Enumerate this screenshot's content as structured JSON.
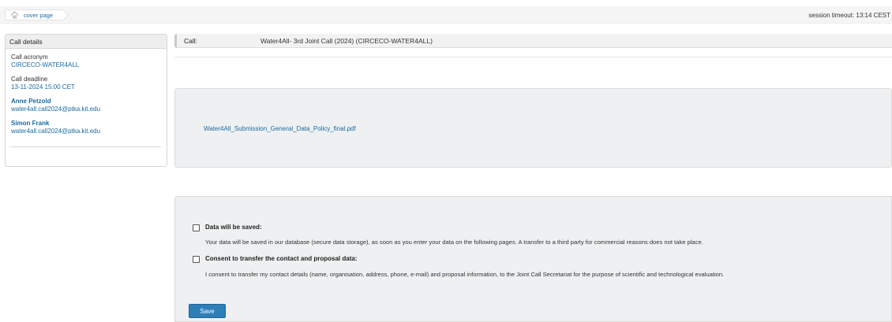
{
  "breadcrumb": {
    "home_icon": "home-icon",
    "label": "cover page"
  },
  "session": {
    "text": "session timeout: 13:14 CEST"
  },
  "sidebar": {
    "title": "Call details",
    "acronym_label": "Call acronym",
    "acronym_value": "CIRCECO-WATER4ALL",
    "deadline_label": "Call deadline",
    "deadline_value": "13-11-2024 15:00 CET",
    "contacts": [
      {
        "name": "Anne Petzold",
        "email": "water4all.call2024@ptka.kit.edu"
      },
      {
        "name": "Simon Frank",
        "email": "water4all.call2024@ptka.kit.edu"
      }
    ]
  },
  "call": {
    "label": "Call:",
    "value": "Water4All- 3rd Joint Call (2024) (CIRCECO-WATER4ALL)"
  },
  "document": {
    "link": "Water4All_Submission_General_Data_Policy_final.pdf"
  },
  "consent": {
    "items": [
      {
        "title": "Data will be saved:",
        "text": "Your data will be saved in our database (secure data storage), as soon as you enter your data on the following pages. A transfer to a third party for commercial reasons does not take place.",
        "checked": false
      },
      {
        "title": "Consent to transfer the contact and proposal data:",
        "text": "I consent to transfer my contact details (name, organisation, address, phone, e-mail) and proposal information, to the Joint Call Secretariat for the purpose of scientific and technological evaluation.",
        "checked": false
      }
    ],
    "save_label": "Save"
  },
  "colors": {
    "link": "#1a6aa3",
    "button": "#2e7fb8",
    "panel_bg": "#eef0f1"
  }
}
